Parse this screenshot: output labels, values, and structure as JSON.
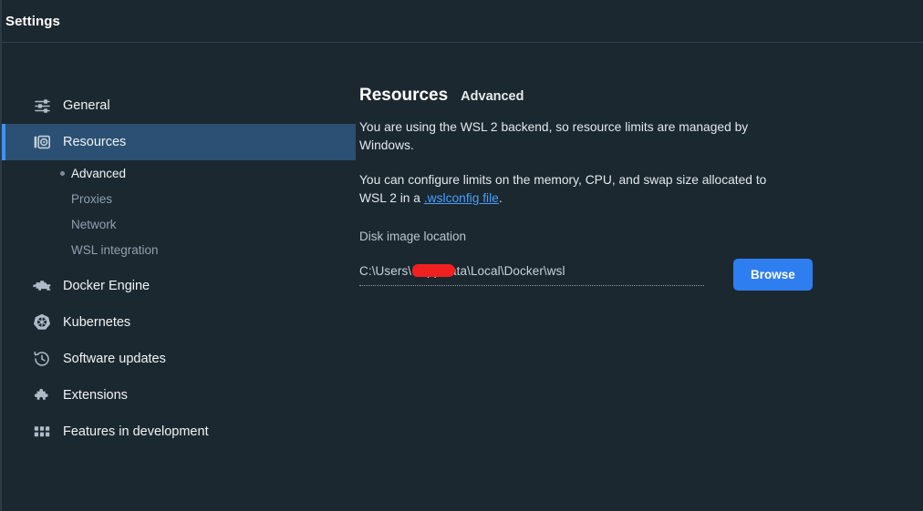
{
  "window": {
    "title": "Settings"
  },
  "sidebar": {
    "items": [
      {
        "label": "General",
        "icon": "sliders-icon",
        "active": false
      },
      {
        "label": "Resources",
        "icon": "resources-gauge-icon",
        "active": true
      },
      {
        "label": "Docker Engine",
        "icon": "engine-icon",
        "active": false
      },
      {
        "label": "Kubernetes",
        "icon": "kubernetes-helm-icon",
        "active": false
      },
      {
        "label": "Software updates",
        "icon": "clock-rewind-icon",
        "active": false
      },
      {
        "label": "Extensions",
        "icon": "puzzle-piece-icon",
        "active": false
      },
      {
        "label": "Features in development",
        "icon": "grid-icon",
        "active": false
      }
    ],
    "sub_items": [
      {
        "label": "Advanced",
        "active": true
      },
      {
        "label": "Proxies",
        "active": false
      },
      {
        "label": "Network",
        "active": false
      },
      {
        "label": "WSL integration",
        "active": false
      }
    ]
  },
  "main": {
    "title": "Resources",
    "subtitle": "Advanced",
    "paragraph_1": "You are using the WSL 2 backend, so resource limits are managed by Windows.",
    "paragraph_2_before": "You can configure limits on the memory, CPU, and swap size allocated to WSL 2 in a ",
    "paragraph_2_link": ".wslconfig file",
    "paragraph_2_after": ".",
    "disk_image_label": "Disk image location",
    "disk_image_path": "C:\\Users\\                \\AppData\\Local\\Docker\\wsl",
    "browse_label": "Browse"
  },
  "colors": {
    "background": "#1b2830",
    "active_nav_bg": "#2b5073",
    "accent_bar": "#3f93ef",
    "link": "#4a9eff",
    "button": "#2f7ef0",
    "redaction": "#ef2020"
  }
}
